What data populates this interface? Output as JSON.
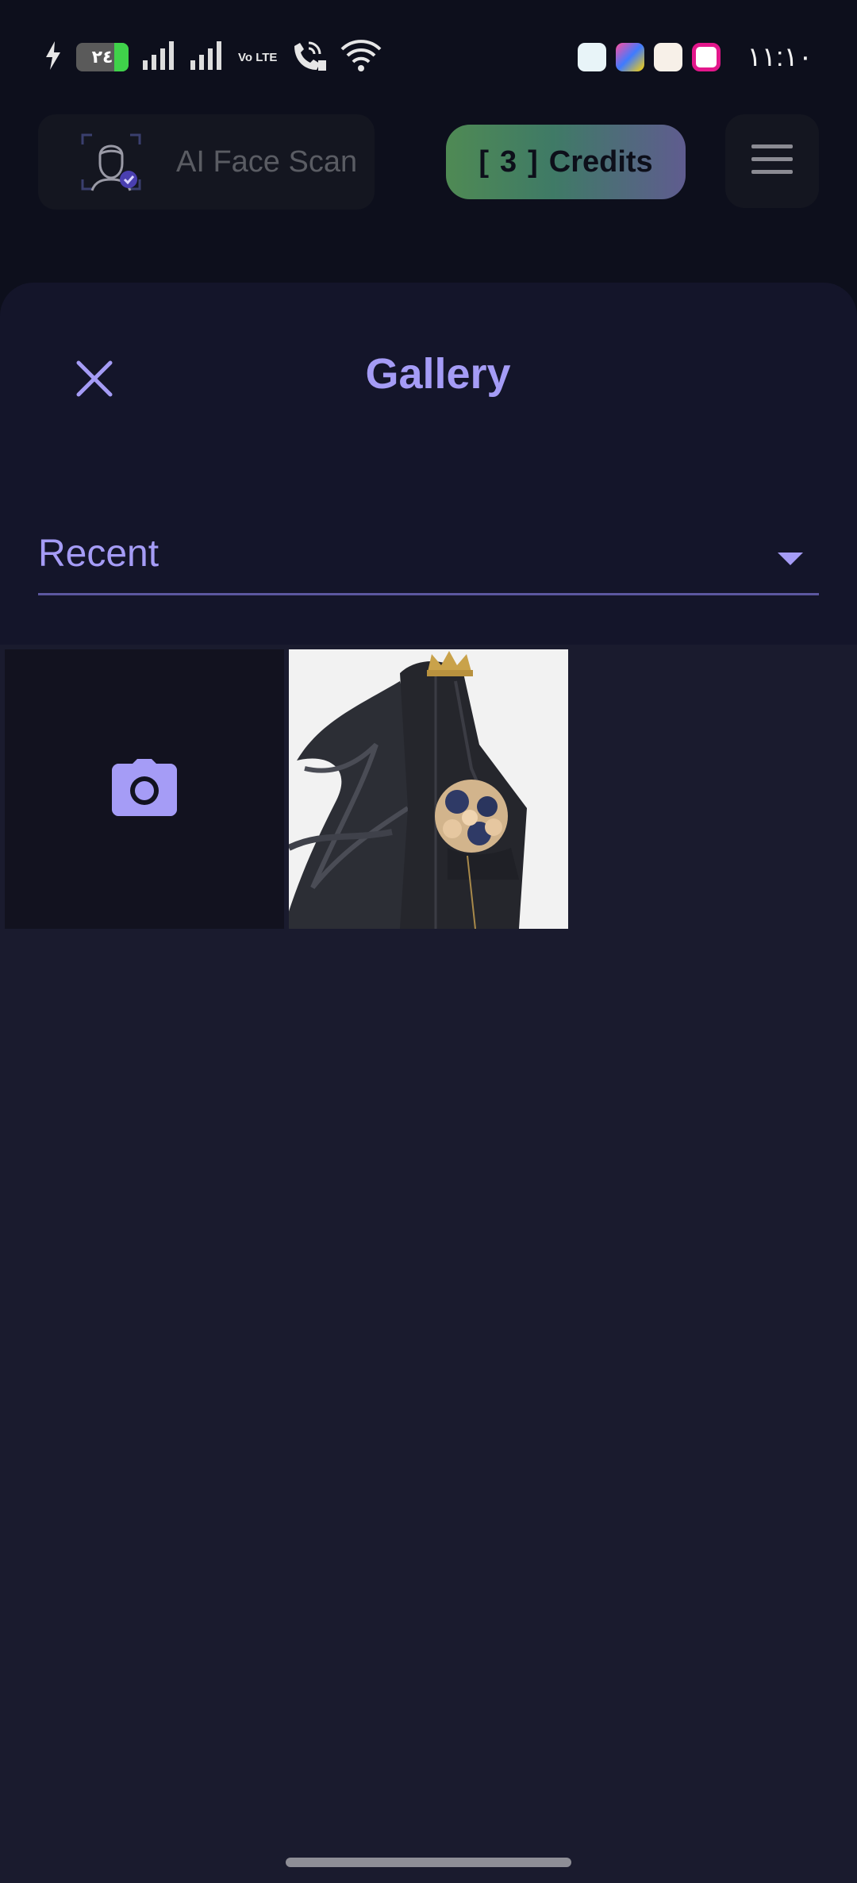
{
  "status_bar": {
    "battery_level": "٢٤",
    "network_label": "Vo LTE",
    "time": "١١:١٠",
    "icons": [
      "charging-icon",
      "battery-icon",
      "signal-icon",
      "signal-icon",
      "volte-icon",
      "wifi-calling-icon",
      "wifi-icon",
      "notification-app-icons"
    ]
  },
  "header": {
    "brand_title": "AI Face Scan",
    "credits": {
      "open_bracket": "[",
      "count": "3",
      "close_bracket": "]",
      "label": "Credits"
    },
    "menu_icon": "hamburger-menu-icon"
  },
  "gallery": {
    "title": "Gallery",
    "close_icon": "close-icon",
    "album_select": {
      "selected": "Recent",
      "icon": "dropdown-caret-icon"
    },
    "tiles": [
      {
        "type": "camera",
        "icon": "camera-icon"
      },
      {
        "type": "photo",
        "subject": "figure in black robe with gold crown holding bouquet"
      }
    ]
  },
  "colors": {
    "background": "#0d0f1c",
    "sheet": "#14152a",
    "accent": "#a59cf6",
    "grid_background": "#1a1b2e",
    "credits_gradient_start": "#4f8a54",
    "credits_gradient_end": "#5f5c8f"
  }
}
